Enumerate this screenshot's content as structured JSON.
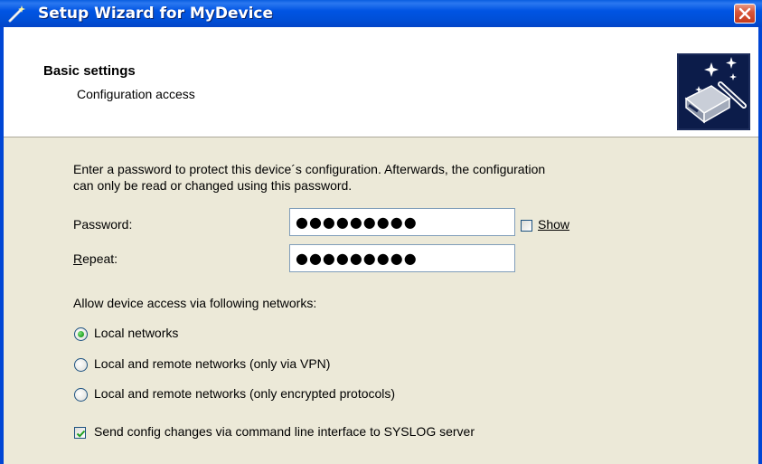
{
  "window": {
    "title": "Setup Wizard for MyDevice",
    "close_icon": "close-icon"
  },
  "header": {
    "title": "Basic settings",
    "subtitle": "Configuration access",
    "logo_icon": "device-wizard-icon"
  },
  "main": {
    "intro_line1": "Enter a password to protect this device´s configuration. Afterwards, the configuration",
    "intro_line2": "can only be read or changed using this password.",
    "password_label": "Password:",
    "password_value": "●●●●●●●●●",
    "show_label": "Show",
    "show_checked": false,
    "repeat_label_prefix": "R",
    "repeat_label_rest": "epeat:",
    "repeat_value": "●●●●●●●●●",
    "networks_label": "Allow device access via following networks:",
    "network_options": [
      {
        "label": "Local networks",
        "selected": true
      },
      {
        "label": "Local and remote networks (only via VPN)",
        "selected": false
      },
      {
        "label": "Local and remote networks (only encrypted protocols)",
        "selected": false
      }
    ],
    "syslog_label": "Send config changes via command line interface to SYSLOG server",
    "syslog_checked": true
  },
  "colors": {
    "titlebar": "#0054e3",
    "dialog_bg": "#ece9d8",
    "radio_dot": "#21a121",
    "check_mark": "#21a121"
  }
}
